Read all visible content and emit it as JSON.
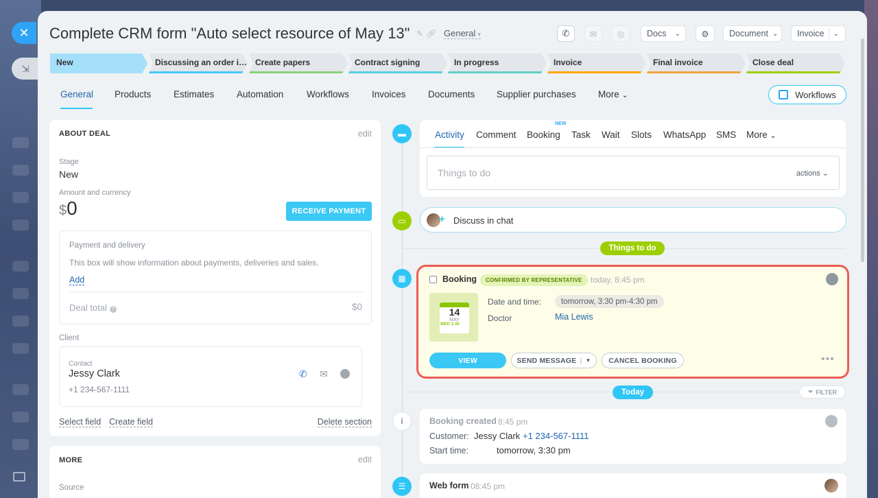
{
  "window": {
    "title": "Complete CRM form \"Auto select resource of May 13\"",
    "category": "General"
  },
  "toolbar": {
    "docs": "Docs",
    "document": "Document",
    "invoice": "Invoice"
  },
  "stages": [
    {
      "label": "New",
      "color": "#a5e0fb"
    },
    {
      "label": "Discussing an order i…",
      "color": "#47c8f6"
    },
    {
      "label": "Create papers",
      "color": "#8bd07a"
    },
    {
      "label": "Contract signing",
      "color": "#55d0e0"
    },
    {
      "label": "In progress",
      "color": "#5fd1c8"
    },
    {
      "label": "Invoice",
      "color": "#ffa900"
    },
    {
      "label": "Final invoice",
      "color": "#f0a540"
    },
    {
      "label": "Close deal",
      "color": "#9dcf00"
    }
  ],
  "tabs": [
    "General",
    "Products",
    "Estimates",
    "Automation",
    "Workflows",
    "Invoices",
    "Documents",
    "Supplier purchases",
    "More"
  ],
  "workflows_button": "Workflows",
  "about": {
    "title": "ABOUT DEAL",
    "edit": "edit",
    "stage_label": "Stage",
    "stage_value": "New",
    "amount_label": "Amount and currency",
    "currency": "$",
    "amount": "0",
    "receive_payment": "RECEIVE PAYMENT",
    "payment_title": "Payment and delivery",
    "payment_text": "This box will show information about payments, deliveries and sales.",
    "add": "Add",
    "deal_total_label": "Deal total",
    "deal_total": "$0",
    "client_label": "Client",
    "contact_label": "Contact",
    "contact_name": "Jessy Clark",
    "contact_phone": "+1 234-567-1111",
    "select_field": "Select field",
    "create_field": "Create field",
    "delete_section": "Delete section"
  },
  "more_section": {
    "title": "MORE",
    "edit": "edit",
    "source_label": "Source"
  },
  "activity": {
    "tabs": [
      "Activity",
      "Comment",
      "Booking",
      "Task",
      "Wait",
      "Slots",
      "WhatsApp",
      "SMS",
      "More"
    ],
    "new_badge": "NEW",
    "placeholder": "Things to do",
    "actions": "actions"
  },
  "chat": {
    "label": "Discuss in chat"
  },
  "things_to_do": "Things to do",
  "booking": {
    "title": "Booking",
    "status": "CONFIRMED BY REPRESENTATIVE",
    "time": "today, 8:45 pm",
    "cal_day": "14",
    "cal_month": "MAY",
    "cal_sub": "WED 3:30",
    "date_label": "Date and time:",
    "date_value": "tomorrow, 3:30 pm-4:30 pm",
    "doctor_label": "Doctor",
    "doctor_value": "Mia Lewis",
    "view": "VIEW",
    "send_message": "SEND MESSAGE",
    "cancel": "CANCEL BOOKING"
  },
  "today": "Today",
  "filter": "FILTER",
  "created": {
    "title": "Booking created",
    "time": "8:45 pm",
    "customer_label": "Customer:",
    "customer_name": "Jessy Clark",
    "customer_phone": "+1 234-567-1111",
    "start_label": "Start time:",
    "start_value": "tomorrow, 3:30 pm"
  },
  "webform": {
    "title": "Web form",
    "time": "08:45 pm"
  }
}
